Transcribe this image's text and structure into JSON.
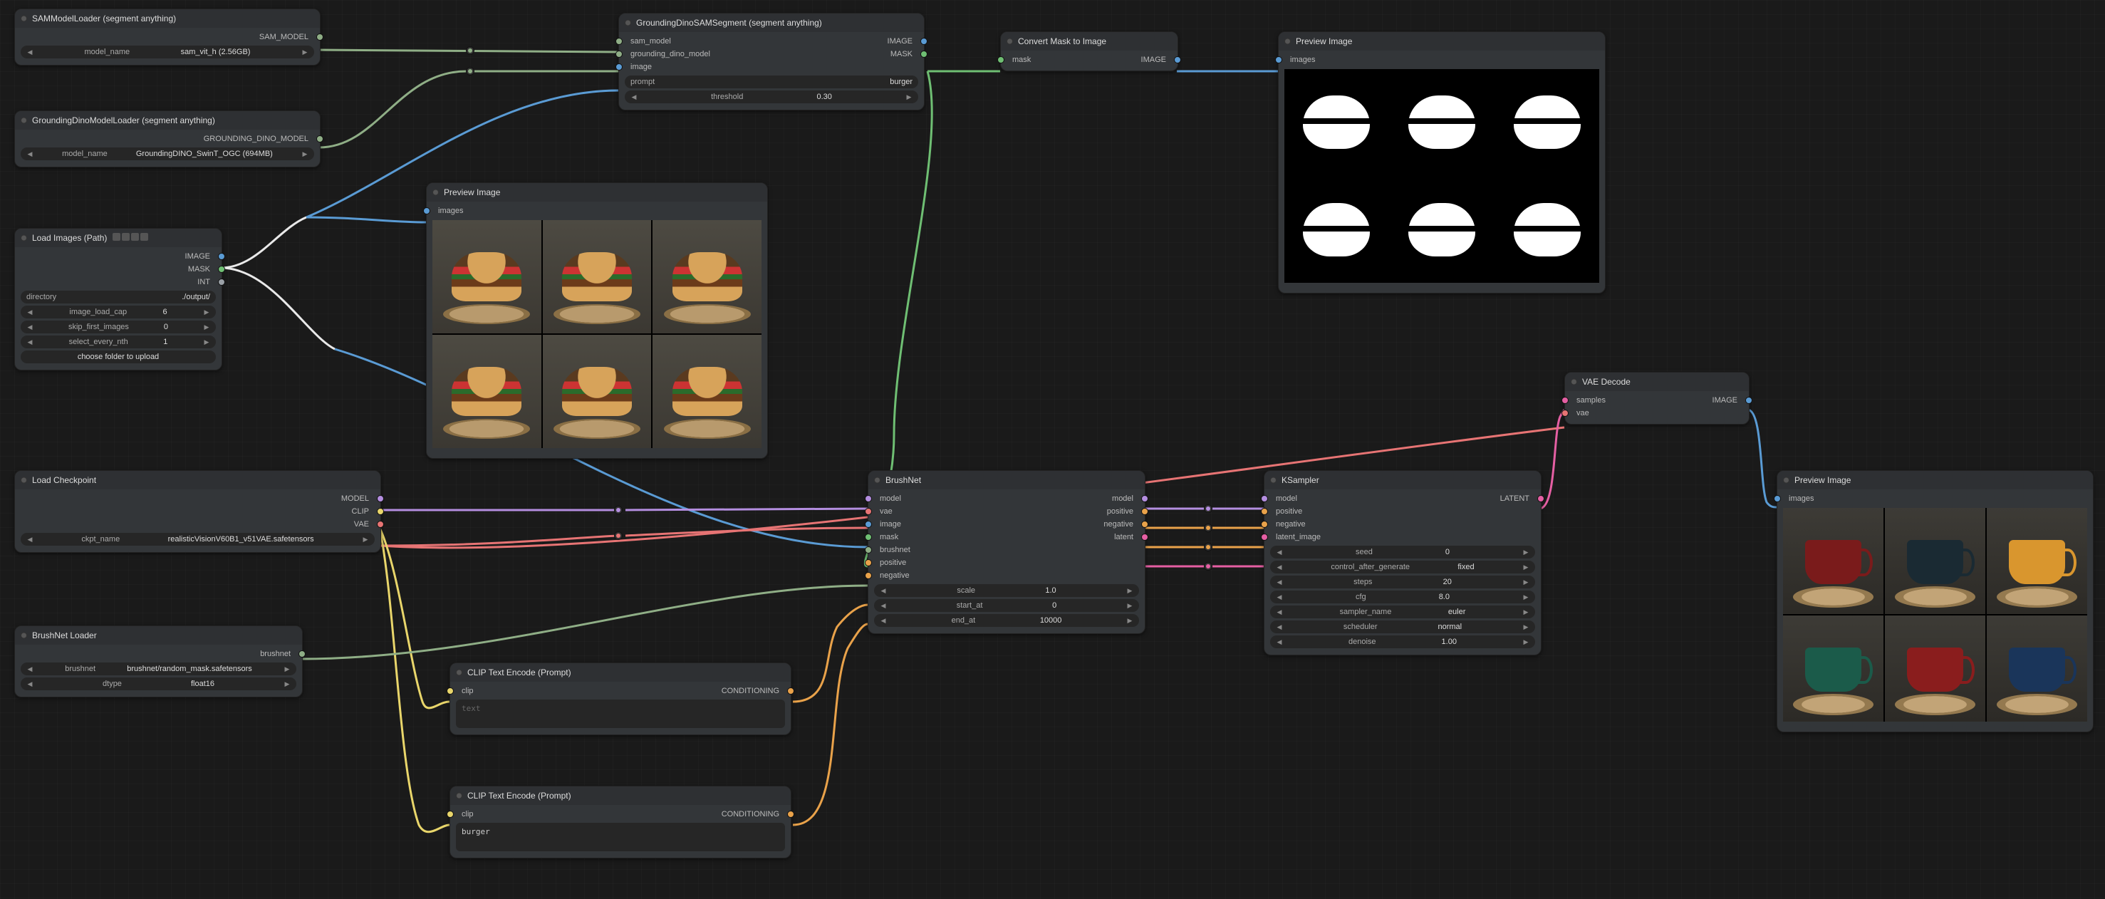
{
  "nodes": {
    "sam_loader": {
      "title": "SAMModelLoader (segment anything)",
      "outputs": [
        {
          "label": "SAM_MODEL",
          "color": "#8fae86"
        }
      ],
      "widgets": [
        {
          "name": "model_name",
          "value": "sam_vit_h (2.56GB)"
        }
      ]
    },
    "gdino_loader": {
      "title": "GroundingDinoModelLoader (segment anything)",
      "outputs": [
        {
          "label": "GROUNDING_DINO_MODEL",
          "color": "#8fae86"
        }
      ],
      "widgets": [
        {
          "name": "model_name",
          "value": "GroundingDINO_SwinT_OGC (694MB)"
        }
      ]
    },
    "load_images": {
      "title": "Load Images (Path)",
      "icons": [
        "film-icon",
        "v-icon",
        "h-icon",
        "s-icon"
      ],
      "outputs": [
        {
          "label": "IMAGE",
          "color": "#5a9bd4"
        },
        {
          "label": "MASK",
          "color": "#6fbf73"
        },
        {
          "label": "INT",
          "color": "#9aa0a6"
        }
      ],
      "widgets": [
        {
          "name": "directory",
          "value": "./output/"
        },
        {
          "name": "image_load_cap",
          "value": "6"
        },
        {
          "name": "skip_first_images",
          "value": "0"
        },
        {
          "name": "select_every_nth",
          "value": "1"
        }
      ],
      "button": "choose folder to upload"
    },
    "gdino_sam": {
      "title": "GroundingDinoSAMSegment (segment anything)",
      "inputs": [
        {
          "label": "sam_model",
          "color": "#8fae86"
        },
        {
          "label": "grounding_dino_model",
          "color": "#8fae86"
        },
        {
          "label": "image",
          "color": "#5a9bd4"
        }
      ],
      "outputs": [
        {
          "label": "IMAGE",
          "color": "#5a9bd4"
        },
        {
          "label": "MASK",
          "color": "#6fbf73"
        }
      ],
      "widgets": [
        {
          "name": "prompt",
          "value": "burger"
        },
        {
          "name": "threshold",
          "value": "0.30"
        }
      ]
    },
    "mask2img": {
      "title": "Convert Mask to Image",
      "inputs": [
        {
          "label": "mask",
          "color": "#6fbf73"
        }
      ],
      "outputs": [
        {
          "label": "IMAGE",
          "color": "#5a9bd4"
        }
      ]
    },
    "preview_mask": {
      "title": "Preview Image",
      "inputs": [
        {
          "label": "images",
          "color": "#5a9bd4"
        }
      ]
    },
    "preview_burgers": {
      "title": "Preview Image",
      "inputs": [
        {
          "label": "images",
          "color": "#5a9bd4"
        }
      ]
    },
    "load_ckpt": {
      "title": "Load Checkpoint",
      "outputs": [
        {
          "label": "MODEL",
          "color": "#b48ee0"
        },
        {
          "label": "CLIP",
          "color": "#e9d66b"
        },
        {
          "label": "VAE",
          "color": "#e77474"
        }
      ],
      "widgets": [
        {
          "name": "ckpt_name",
          "value": "realisticVisionV60B1_v51VAE.safetensors"
        }
      ]
    },
    "brushnet_loader": {
      "title": "BrushNet Loader",
      "outputs": [
        {
          "label": "brushnet",
          "color": "#8fae86"
        }
      ],
      "widgets": [
        {
          "name": "brushnet",
          "value": "brushnet/random_mask.safetensors"
        },
        {
          "name": "dtype",
          "value": "float16"
        }
      ]
    },
    "clip_pos": {
      "title": "CLIP Text Encode (Prompt)",
      "inputs": [
        {
          "label": "clip",
          "color": "#e9d66b"
        }
      ],
      "outputs": [
        {
          "label": "CONDITIONING",
          "color": "#e9a24a"
        }
      ],
      "placeholder": "text",
      "text": ""
    },
    "clip_neg": {
      "title": "CLIP Text Encode (Prompt)",
      "inputs": [
        {
          "label": "clip",
          "color": "#e9d66b"
        }
      ],
      "outputs": [
        {
          "label": "CONDITIONING",
          "color": "#e9a24a"
        }
      ],
      "text": "burger"
    },
    "brushnet": {
      "title": "BrushNet",
      "inputs": [
        {
          "label": "model",
          "color": "#b48ee0"
        },
        {
          "label": "vae",
          "color": "#e77474"
        },
        {
          "label": "image",
          "color": "#5a9bd4"
        },
        {
          "label": "mask",
          "color": "#6fbf73"
        },
        {
          "label": "brushnet",
          "color": "#8fae86"
        },
        {
          "label": "positive",
          "color": "#e9a24a"
        },
        {
          "label": "negative",
          "color": "#e9a24a"
        }
      ],
      "outputs": [
        {
          "label": "model",
          "color": "#b48ee0"
        },
        {
          "label": "positive",
          "color": "#e9a24a"
        },
        {
          "label": "negative",
          "color": "#e9a24a"
        },
        {
          "label": "latent",
          "color": "#e55fa3"
        }
      ],
      "widgets": [
        {
          "name": "scale",
          "value": "1.0"
        },
        {
          "name": "start_at",
          "value": "0"
        },
        {
          "name": "end_at",
          "value": "10000"
        }
      ]
    },
    "ksampler": {
      "title": "KSampler",
      "inputs": [
        {
          "label": "model",
          "color": "#b48ee0"
        },
        {
          "label": "positive",
          "color": "#e9a24a"
        },
        {
          "label": "negative",
          "color": "#e9a24a"
        },
        {
          "label": "latent_image",
          "color": "#e55fa3"
        }
      ],
      "outputs": [
        {
          "label": "LATENT",
          "color": "#e55fa3"
        }
      ],
      "widgets": [
        {
          "name": "seed",
          "value": "0"
        },
        {
          "name": "control_after_generate",
          "value": "fixed"
        },
        {
          "name": "steps",
          "value": "20"
        },
        {
          "name": "cfg",
          "value": "8.0"
        },
        {
          "name": "sampler_name",
          "value": "euler"
        },
        {
          "name": "scheduler",
          "value": "normal"
        },
        {
          "name": "denoise",
          "value": "1.00"
        }
      ]
    },
    "vae_decode": {
      "title": "VAE Decode",
      "inputs": [
        {
          "label": "samples",
          "color": "#e55fa3"
        },
        {
          "label": "vae",
          "color": "#e77474"
        }
      ],
      "outputs": [
        {
          "label": "IMAGE",
          "color": "#5a9bd4"
        }
      ]
    },
    "preview_cups": {
      "title": "Preview Image",
      "inputs": [
        {
          "label": "images",
          "color": "#5a9bd4"
        }
      ]
    }
  },
  "cup_colors": [
    "#7a1b1b",
    "#1a2a33",
    "#d9962e",
    "#1b5b4a",
    "#8a1d1d",
    "#1a355a"
  ]
}
